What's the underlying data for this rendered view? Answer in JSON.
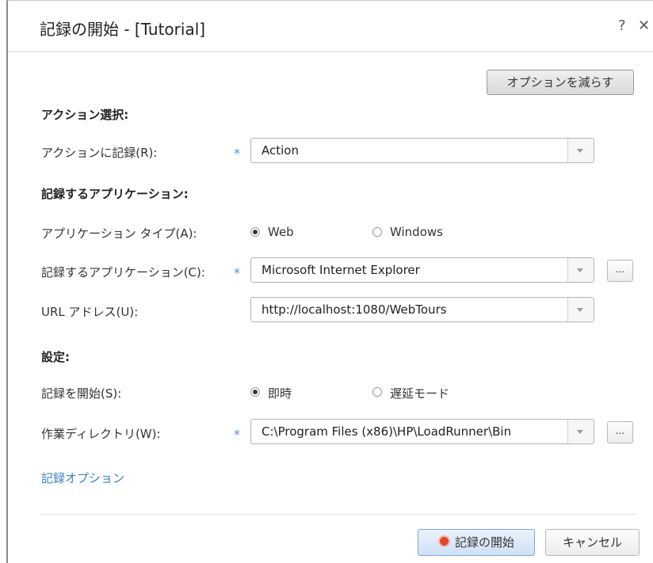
{
  "window": {
    "title": "記録の開始 - [Tutorial]",
    "help_glyph": "?",
    "close_glyph": "✕"
  },
  "buttons": {
    "fewer_options": "オプションを減らす",
    "start_recording": "記録の開始",
    "cancel": "キャンセル",
    "browse": "..."
  },
  "sections": {
    "action_selection": "アクション選択:",
    "recording_application": "記録するアプリケーション:",
    "settings": "設定:"
  },
  "fields": {
    "record_into_action": {
      "label": "アクションに記録(R):",
      "value": "Action",
      "required": "*"
    },
    "application_type": {
      "label": "アプリケーション タイプ(A):",
      "options": [
        "Web",
        "Windows"
      ],
      "selected": "Web"
    },
    "application_to_record": {
      "label": "記録するアプリケーション(C):",
      "value": "Microsoft Internet Explorer",
      "required": "*"
    },
    "url_address": {
      "label": "URL アドレス(U):",
      "value": "http://localhost:1080/WebTours"
    },
    "start_recording": {
      "label": "記録を開始(S):",
      "options": [
        "即時",
        "遅延モード"
      ],
      "selected": "即時"
    },
    "working_directory": {
      "label": "作業ディレクトリ(W):",
      "value": "C:\\Program Files (x86)\\HP\\LoadRunner\\Bin",
      "required": "*"
    }
  },
  "links": {
    "recording_options": "記録オプション"
  },
  "colors": {
    "accent_link": "#3a7ec8",
    "required_marker": "#4a90d9",
    "record_dot": "#e0482e"
  }
}
